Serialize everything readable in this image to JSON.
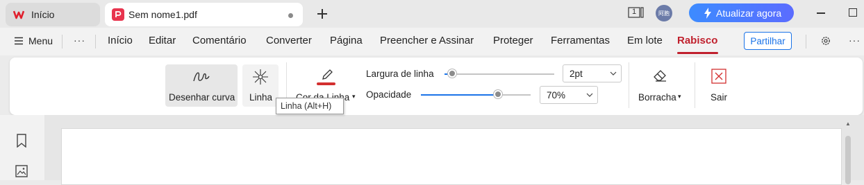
{
  "tabs": {
    "home_label": "Início",
    "doc_label": "Sem nome1.pdf",
    "page_badge": "1",
    "avatar_text": "阿胞",
    "upgrade_label": "Atualizar agora"
  },
  "menu": {
    "menu_label": "Menu",
    "items": [
      "Início",
      "Editar",
      "Comentário",
      "Converter",
      "Página",
      "Preencher e Assinar",
      "Proteger",
      "Ferramentas",
      "Em lote",
      "Rabisco"
    ],
    "share_label": "Partilhar"
  },
  "ribbon": {
    "draw_curve_label": "Desenhar curva",
    "line_label": "Linha",
    "pen_label": "Cor da Linha",
    "line_width_label": "Largura de linha",
    "line_width_value": "2pt",
    "opacity_label": "Opacidade",
    "opacity_value": "70%",
    "opacity_level": 0.7,
    "eraser_label": "Borracha",
    "exit_label": "Sair",
    "tooltip": "Linha (Alt+H)"
  },
  "colors": {
    "accent": "#1a73e8",
    "active_tab": "#c0202d",
    "pen_red": "#d32f2f",
    "upgrade_start": "#3d8bff",
    "upgrade_end": "#5b6cff"
  }
}
